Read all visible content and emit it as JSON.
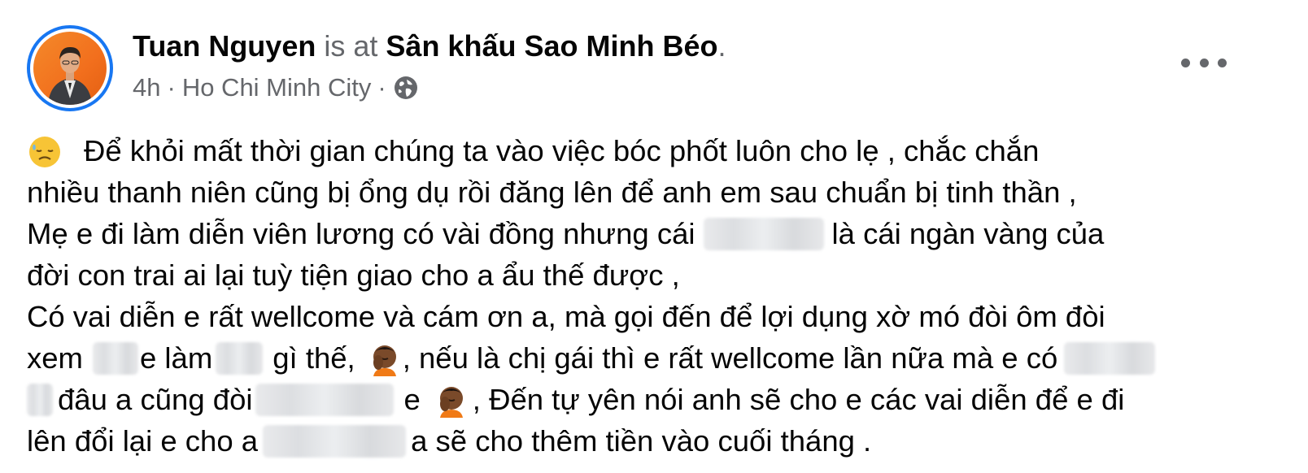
{
  "post": {
    "author": "Tuan Nguyen",
    "status_connector": "is at",
    "location_name": "Sân khấu Sao Minh Béo",
    "trailing_period": ".",
    "time": "4h",
    "separator": "·",
    "city": "Ho Chi Minh City",
    "privacy_icon": "globe-icon",
    "more_icon": "more-options-icon"
  },
  "text": {
    "l1": "Để khỏi mất thời gian chúng ta vào việc bóc phốt luôn cho lẹ , chắc chắn",
    "l2": "nhiều thanh niên cũng bị ổng dụ rồi đăng lên để anh em sau chuẩn bị tinh thần ,",
    "l3a": "Mẹ e đi làm diễn viên lương có vài đồng nhưng cái",
    "l3b": "là cái ngàn vàng của",
    "l4": "đời con trai ai lại tuỳ tiện giao cho a ẩu thế được ,",
    "l5": "Có vai diễn e rất wellcome và cám ơn a, mà gọi đến để lợi dụng xờ mó đòi ôm đòi",
    "l6a": "xem",
    "l6b": "e làm",
    "l6c": "gì thế,",
    "l6d": ", nếu là chị gái thì e rất wellcome lần nữa mà e có",
    "l7a": "đâu a cũng đòi",
    "l7b": "e",
    "l7c": ", Đến tự yên nói anh sẽ cho e các vai diễn để e đi",
    "l8a": "lên đổi lại e cho a",
    "l8b": "a sẽ cho thêm tiền vào cuối tháng ."
  },
  "colors": {
    "accent": "#1877f2",
    "muted_text": "#65676b",
    "avatar_bg": "#f26f1d"
  }
}
